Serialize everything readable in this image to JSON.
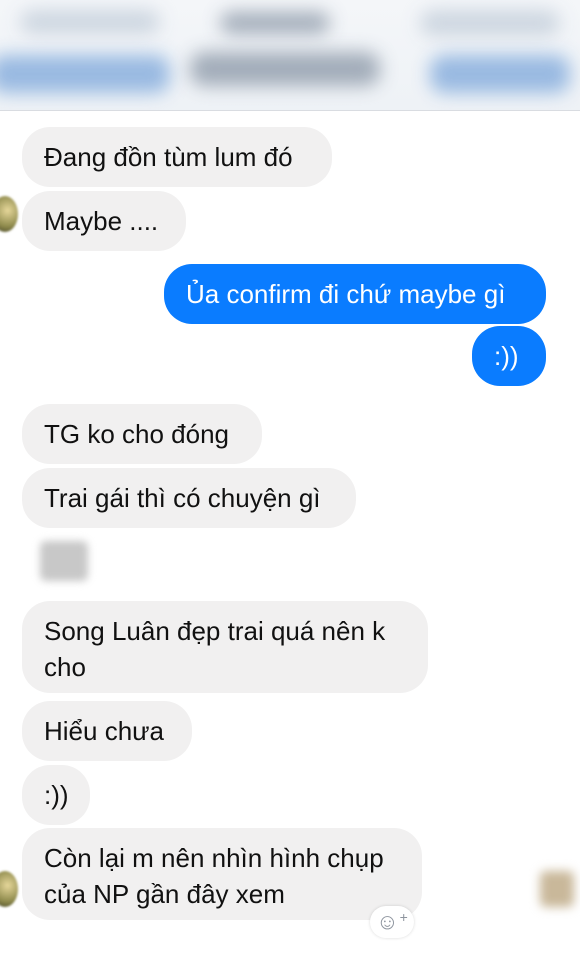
{
  "messages": [
    {
      "text": "Đang đồn tùm lum đó",
      "direction": "incoming"
    },
    {
      "text": "Maybe ....",
      "direction": "incoming"
    },
    {
      "text": "Ủa confirm đi chứ maybe gì",
      "direction": "outgoing"
    },
    {
      "text": ":))",
      "direction": "outgoing"
    },
    {
      "text": "TG ko cho đóng",
      "direction": "incoming"
    },
    {
      "text": "Trai gái thì có chuyện gì",
      "direction": "incoming"
    },
    {
      "text": "Song Luân đẹp trai quá nên k\ncho",
      "direction": "incoming"
    },
    {
      "text": "Hiểu chưa",
      "direction": "incoming"
    },
    {
      "text": ":))",
      "direction": "incoming"
    },
    {
      "text": "Còn lại m nên nhìn hình chụp\ncủa NP gần đây xem",
      "direction": "incoming"
    }
  ],
  "icons": {
    "reaction": "smiley-plus-icon",
    "avatar": "contact-avatar"
  },
  "colors": {
    "outgoing_bubble": "#0a7cff",
    "incoming_bubble": "#f1f0f0",
    "background": "#ffffff"
  }
}
